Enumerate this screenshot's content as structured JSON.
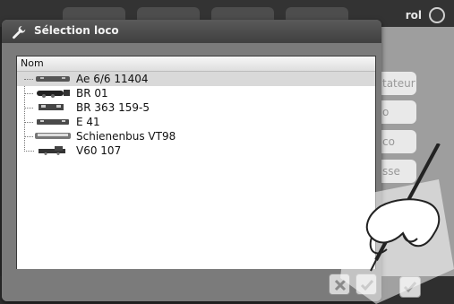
{
  "background": {
    "control_label": "rol",
    "right_buttons": [
      "tateur",
      "o",
      "co",
      "sse"
    ]
  },
  "dialog": {
    "title": "Sélection loco",
    "column_header": "Nom",
    "items": [
      {
        "name": "Ae 6/6 11404",
        "selected": true
      },
      {
        "name": "BR 01",
        "selected": false
      },
      {
        "name": "BR 363 159-5",
        "selected": false
      },
      {
        "name": "E 41",
        "selected": false
      },
      {
        "name": "Schienenbus VT98",
        "selected": false
      },
      {
        "name": "V60 107",
        "selected": false
      }
    ]
  },
  "colors": {
    "dialog_bg": "#7b7b7b",
    "header_bg": "#444444",
    "list_bg": "#ffffff",
    "selected_row": "#d9d9d9"
  },
  "icons": [
    "wrench-icon",
    "cancel-x-icon",
    "confirm-check-icon",
    "power-icon"
  ]
}
